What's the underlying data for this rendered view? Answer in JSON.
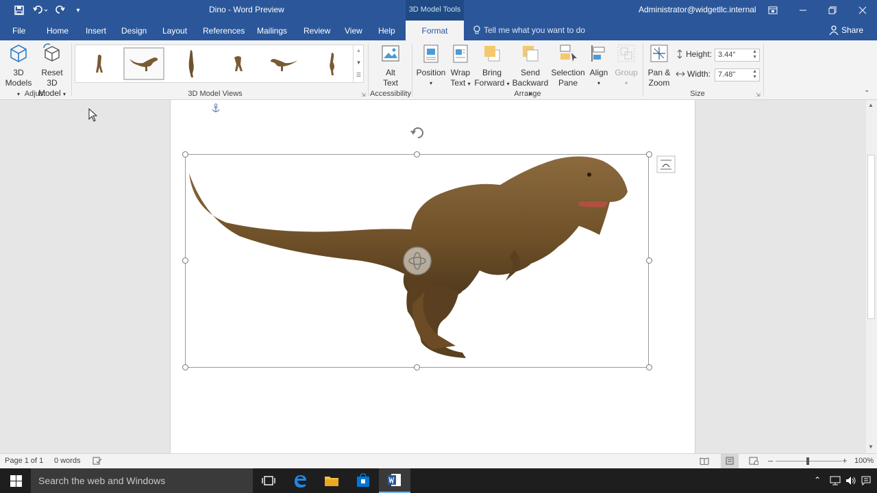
{
  "title_bar": {
    "document_title": "Dino  -  Word Preview",
    "context_tools_label": "3D Model Tools",
    "user": "Administrator@widgetllc.internal"
  },
  "tabs": {
    "file": "File",
    "home": "Home",
    "insert": "Insert",
    "design": "Design",
    "layout": "Layout",
    "references": "References",
    "mailings": "Mailings",
    "review": "Review",
    "view": "View",
    "help": "Help",
    "format": "Format"
  },
  "tell_me": "Tell me what you want to do",
  "share": "Share",
  "ribbon": {
    "models_line1": "3D",
    "models_line2": "Models",
    "reset_line1": "Reset 3D",
    "reset_line2": "Model",
    "alt_line1": "Alt",
    "alt_line2": "Text",
    "position": "Position",
    "wrap_line1": "Wrap",
    "wrap_line2": "Text",
    "bring_line1": "Bring",
    "bring_line2": "Forward",
    "send_line1": "Send",
    "send_line2": "Backward",
    "selection_line1": "Selection",
    "selection_line2": "Pane",
    "align": "Align",
    "group": "Group",
    "panzoom_line1": "Pan &",
    "panzoom_line2": "Zoom",
    "height_label": "Height:",
    "height_value": "3.44\"",
    "width_label": "Width:",
    "width_value": "7.48\"",
    "groups": {
      "adjust": "Adjust",
      "views": "3D Model Views",
      "accessibility": "Accessibility",
      "arrange": "Arrange",
      "size": "Size"
    }
  },
  "status": {
    "page": "Page 1 of 1",
    "words": "0 words",
    "zoom": "100%"
  },
  "taskbar": {
    "search_placeholder": "Search the web and Windows"
  },
  "colors": {
    "accent": "#2b579a",
    "ribbon_bg": "#f3f3f3",
    "taskbar": "#1e1e1e"
  }
}
